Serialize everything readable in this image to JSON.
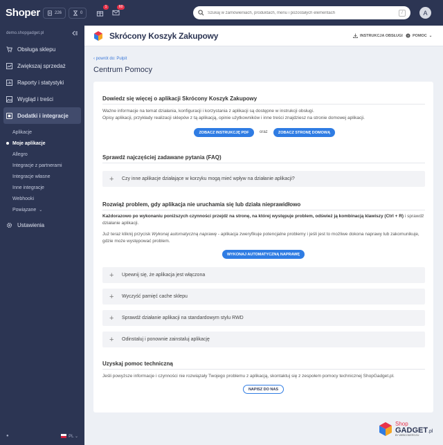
{
  "topbar": {
    "logo": "Shoper",
    "pill_orders": "226",
    "pill_returns": "0",
    "gift_badge": "1",
    "mail_badge": "60",
    "search_placeholder": "Szukaj w zamówieniach, produktach, menu i pozostałych elementach",
    "search_kbd": "/",
    "avatar_letter": "A"
  },
  "sidebar": {
    "store": "demo.shopgadget.pl",
    "items": [
      {
        "label": "Obsługa sklepu",
        "icon": "cart-icon"
      },
      {
        "label": "Zwiększaj sprzedaż",
        "icon": "chart-icon"
      },
      {
        "label": "Raporty i statystyki",
        "icon": "report-icon"
      },
      {
        "label": "Wygląd i treści",
        "icon": "image-icon"
      },
      {
        "label": "Dodatki i integracje",
        "icon": "puzzle-icon"
      }
    ],
    "subitems": [
      "Aplikacje",
      "Moje aplikacje",
      "Allegro",
      "Integracje z partnerami",
      "Integracje własne",
      "Inne integracje",
      "Webhooki",
      "Powiązane"
    ],
    "settings": "Ustawienia",
    "lang": "PL"
  },
  "header": {
    "title": "Skrócony Koszyk Zakupowy",
    "manual": "INSTRUKCJA OBSŁUGI",
    "help": "POMOC"
  },
  "main": {
    "back": "powrót do: Pulpit",
    "title": "Centrum Pomocy",
    "s1_title": "Dowiedz się więcej o aplikacji Skrócony Koszyk Zakupowy",
    "s1_p1": "Ważne informacje na temat działania, konfiguracji i korzystania z aplikacji są dostępne w instrukcji obsługi.",
    "s1_p2": "Opisy aplikacji, przykłady realizacji sklepów z tą aplikacją, opinie użytkowników i inne treści znajdziesz na stronie domowej aplikacji.",
    "btn_pdf": "ZOBACZ INSTRUKCJĘ PDF",
    "oraz": "oraz",
    "btn_home": "ZOBACZ STRONĘ DOMOWĄ",
    "s2_title": "Sprawdź najczęściej zadawane pytania (FAQ)",
    "faq": "Czy inne aplikacje działające w korzyku mogą mieć wpływ na działanie aplikacji?",
    "s3_title": "Rozwiąż problem, gdy aplikacja nie uruchamia się lub działa nieprawidłowo",
    "s3_bold": "Każdorazowo po wykonaniu poniższych czynności przejdź na stronę, na której występuje problem, odśwież ją kombinacją klawiszy (Ctrl + R)",
    "s3_rest": " i sprawdź działanie aplikacji.",
    "s3_p2a": "Już teraz kliknij przycisk ",
    "s3_p2i": "Wykonaj automatyczną naprawę",
    "s3_p2b": " - aplikacja zweryfikuje potencjalne problemy i jeśli jest to możliwe dokona naprawy lub zakomunikuje, gdzie może występować problem.",
    "btn_fix": "WYKONAJ AUTOMATYCZNĄ NAPRAWĘ",
    "steps": [
      "Upewnij się, że aplikacja jest włączona",
      "Wyczyść pamięć cache sklepu",
      "Sprawdź działanie aplikacji na standardowym stylu RWD",
      "Odinstaluj i ponownie zainstaluj aplikację"
    ],
    "s4_title": "Uzyskaj pomoc techniczną",
    "s4_p": "Jeśli powyższe informacje i czynności nie rozwiązały Twojego problemu z aplikacją, skontaktuj się z zespołem pomocy technicznej ShopGadget.pl.",
    "btn_write": "NAPISZ DO NAS"
  },
  "brand": {
    "shop": "Shop",
    "gadget": "GADGET",
    "suffix": ".pl",
    "sub": "BY WEBCODERS.EU"
  }
}
